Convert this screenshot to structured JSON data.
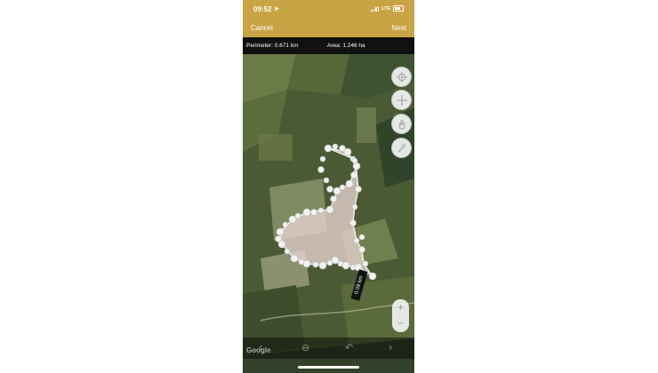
{
  "status_bar": {
    "time": "09:52",
    "network": "LTE"
  },
  "nav": {
    "cancel_label": "Cancel",
    "next_label": "Next"
  },
  "measure": {
    "perimeter": "Perimeter: 0.671 km",
    "area": "Area: 1.246 ha"
  },
  "map": {
    "segment_label": "0.08 km",
    "attribution": "Google"
  },
  "map_controls": [
    "locate-icon",
    "crosshair-icon",
    "hand-icon",
    "magic-icon"
  ],
  "zoom": {
    "plus": "+",
    "minus": "−"
  },
  "toolbar": [
    "chevron-left-icon",
    "delete-icon",
    "undo-icon",
    "chevron-right-icon"
  ],
  "colors": {
    "header": "#c9a444",
    "info_bar": "#111111",
    "polygon_fill": "#e8d2d2"
  }
}
